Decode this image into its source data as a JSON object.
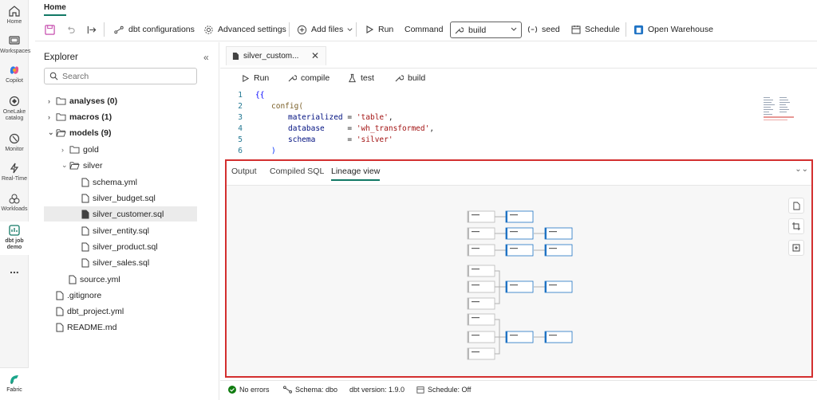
{
  "rail": {
    "items": [
      {
        "label": "Home"
      },
      {
        "label": "Workspaces"
      },
      {
        "label": "Copilot"
      },
      {
        "label": "OneLake catalog"
      },
      {
        "label": "Monitor"
      },
      {
        "label": "Real-Time"
      },
      {
        "label": "Workloads"
      },
      {
        "label": "dbt job demo"
      },
      {
        "label": "..."
      }
    ],
    "fabric_label": "Fabric"
  },
  "tabs": {
    "home": "Home"
  },
  "toolbar": {
    "dbt_configurations": "dbt configurations",
    "advanced_settings": "Advanced settings",
    "add_files": "Add files",
    "run": "Run",
    "command": "Command",
    "command_value": "build",
    "seed": "seed",
    "schedule": "Schedule",
    "open_warehouse": "Open Warehouse"
  },
  "explorer": {
    "title": "Explorer",
    "search_placeholder": "Search",
    "tree": [
      {
        "label": "analyses (0)"
      },
      {
        "label": "macros (1)"
      },
      {
        "label": "models (9)"
      },
      {
        "label": "gold"
      },
      {
        "label": "silver"
      },
      {
        "label": "schema.yml"
      },
      {
        "label": "silver_budget.sql"
      },
      {
        "label": "silver_customer.sql"
      },
      {
        "label": "silver_entity.sql"
      },
      {
        "label": "silver_product.sql"
      },
      {
        "label": "silver_sales.sql"
      },
      {
        "label": "source.yml"
      },
      {
        "label": ".gitignore"
      },
      {
        "label": "dbt_project.yml"
      },
      {
        "label": "README.md"
      }
    ]
  },
  "editor": {
    "tab_label": "silver_custom...",
    "actions": {
      "run": "Run",
      "compile": "compile",
      "test": "test",
      "build": "build"
    },
    "lines": [
      {
        "n": "1",
        "t": "{{"
      },
      {
        "n": "2",
        "t": "config("
      },
      {
        "n": "3",
        "key": "materialized",
        "pad": " = ",
        "val": "'table'",
        "tail": ","
      },
      {
        "n": "4",
        "key": "database",
        "pad": "     = ",
        "val": "'wh_transformed'",
        "tail": ","
      },
      {
        "n": "5",
        "key": "schema",
        "pad": "       = ",
        "val": "'silver'",
        "tail": ""
      },
      {
        "n": "6",
        "t": ")"
      }
    ]
  },
  "panel": {
    "tabs": {
      "output": "Output",
      "compiled_sql": "Compiled SQL",
      "lineage_view": "Lineage view"
    },
    "active_tab": "Lineage view"
  },
  "status": {
    "errors": "No errors",
    "schema": "Schema: dbo",
    "dbt_version": "dbt version: 1.9.0",
    "schedule": "Schedule: Off"
  },
  "colors": {
    "accent": "#117865",
    "highlight_border": "#d32f2f",
    "node_blue": "#1f73c4"
  }
}
